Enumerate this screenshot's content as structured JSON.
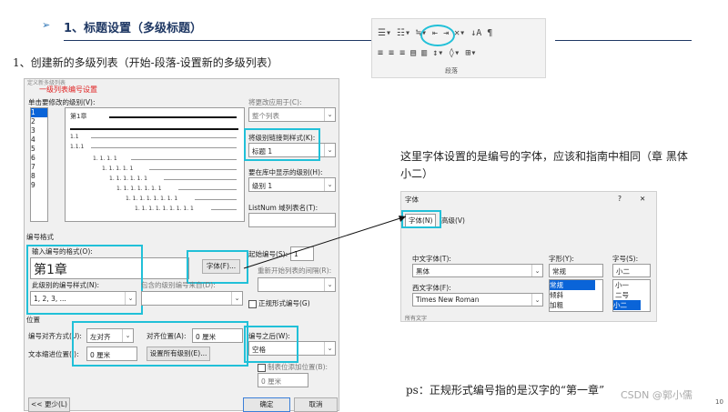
{
  "slide": {
    "title_arrow": "➢",
    "title": "1、标题设置（多级标题）",
    "step": "1、创建新的多级列表（开始-段落-设置新的多级列表）",
    "note": "这里字体设置的是编号的字体，应该和指南中相同（章 黑体 小二）",
    "ps": "ps：正规形式编号指的是汉字的“第一章”",
    "watermark": "CSDN @郭小儒",
    "page_number": "10"
  },
  "ribbon": {
    "row1": "☰▾ ☷▾ ≒▾ ⇤ ⇥ ✕▾ ↓A ¶",
    "row2": "≡ ≡ ≡ ▤ ▥ ↕▾ ◊▾ ⊞▾",
    "group_label": "段落"
  },
  "multilevel_dialog": {
    "title": "定义新多级列表",
    "annotation": "一级列表编号设置",
    "level_label": "单击要修改的级别(V):",
    "levels": [
      "1",
      "2",
      "3",
      "4",
      "5",
      "6",
      "7",
      "8",
      "9"
    ],
    "selected_level": "1",
    "preview_lines": [
      "第1章",
      "1.1",
      "1.1.1",
      "1. 1. 1. 1",
      "1. 1. 1. 1. 1",
      "1. 1. 1. 1. 1. 1",
      "1. 1. 1. 1. 1. 1. 1",
      "1. 1. 1. 1. 1. 1. 1. 1",
      "1. 1. 1. 1. 1. 1. 1. 1. 1"
    ],
    "apply_to_label": "将更改应用于(C):",
    "apply_to_value": "整个列表",
    "link_style_label": "将级别链接到样式(K):",
    "link_style_value": "标题 1",
    "gallery_level_label": "要在库中显示的级别(H):",
    "gallery_level_value": "级别 1",
    "listnum_label": "ListNum 域列表名(T):",
    "number_format_section": "编号格式",
    "number_format_label": "输入编号的格式(O):",
    "number_format_value": "第1章",
    "font_button": "字体(F)...",
    "number_style_label": "此级别的编号样式(N):",
    "number_style_value": "1, 2, 3, ...",
    "include_level_label": "包含的级别编号来自(D):",
    "start_at_label": "起始编号(S):",
    "start_at_value": "1",
    "restart_label": "重新开始列表的间隔(R):",
    "legal_label": "正规形式编号(G)",
    "position_section": "位置",
    "alignment_label": "编号对齐方式(U):",
    "alignment_value": "左对齐",
    "aligned_at_label": "对齐位置(A):",
    "aligned_at_value": "0 厘米",
    "indent_label": "文本缩进位置(I):",
    "indent_value": "0 厘米",
    "set_all_button": "设置所有级别(E)...",
    "follow_label": "编号之后(W):",
    "follow_value": "空格",
    "tab_stop_label": "制表位添加位置(B):",
    "tab_stop_value": "0 厘米",
    "less_button": "<< 更少(L)",
    "ok_button": "确定",
    "cancel_button": "取消"
  },
  "font_dialog": {
    "title": "字体",
    "help": "?",
    "close": "✕",
    "tab_font": "字体(N)",
    "tab_advanced": "高级(V)",
    "cjk_font_label": "中文字体(T):",
    "cjk_font_value": "黑体",
    "style_label": "字形(Y):",
    "style_value": "常规",
    "style_options": [
      "常规",
      "倾斜",
      "加粗"
    ],
    "size_label": "字号(S):",
    "size_value": "小二",
    "size_options": [
      "小一",
      "二号",
      "小二"
    ],
    "western_font_label": "西文字体(F):",
    "western_font_value": "Times New Roman",
    "all_text_label": "所有文字"
  },
  "colors": {
    "accent": "#21c0d8",
    "title": "#1f3864",
    "annotation": "#e02020"
  }
}
